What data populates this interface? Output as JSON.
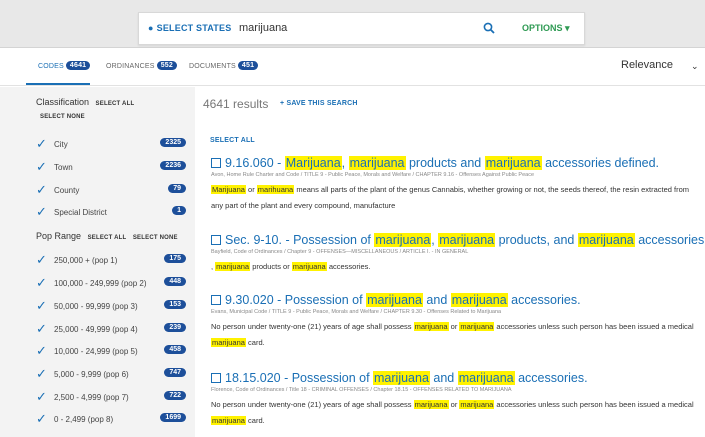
{
  "search": {
    "select_states_label": "SELECT STATES",
    "query": "marijuana",
    "options_label": "OPTIONS"
  },
  "tabs": [
    {
      "label": "CODES",
      "count": "4641",
      "active": true
    },
    {
      "label": "ORDINANCES",
      "count": "552",
      "active": false
    },
    {
      "label": "DOCUMENTS",
      "count": "451",
      "active": false
    }
  ],
  "sort": {
    "value": "Relevance"
  },
  "sidebar": {
    "classification_label": "Classification",
    "select_all": "SELECT ALL",
    "select_none": "SELECT NONE",
    "classifications": [
      {
        "label": "City",
        "count": "2325"
      },
      {
        "label": "Town",
        "count": "2236"
      },
      {
        "label": "County",
        "count": "79"
      },
      {
        "label": "Special District",
        "count": "1"
      }
    ],
    "pop_range_label": "Pop Range",
    "pop_ranges": [
      {
        "label": "250,000 + (pop 1)",
        "count": "175"
      },
      {
        "label": "100,000 - 249,999 (pop 2)",
        "count": "448"
      },
      {
        "label": "50,000 - 99,999 (pop 3)",
        "count": "153"
      },
      {
        "label": "25,000 - 49,999 (pop 4)",
        "count": "239"
      },
      {
        "label": "10,000 - 24,999 (pop 5)",
        "count": "458"
      },
      {
        "label": "5,000 - 9,999 (pop 6)",
        "count": "747"
      },
      {
        "label": "2,500 - 4,999 (pop 7)",
        "count": "722"
      },
      {
        "label": "0 - 2,499 (pop 8)",
        "count": "1699"
      }
    ]
  },
  "main": {
    "results_count": "4641 results",
    "save_search": "SAVE THIS SEARCH",
    "select_all": "SELECT ALL",
    "highlight_term": "marijuana",
    "results": [
      {
        "title": "9.16.060 - Marijuana, marijuana products and marijuana accessories defined.",
        "crumb": "Avon, Home Rule Charter and Code  /  TITLE 9 - Public Peace, Morals and Welfare  /  CHAPTER 9.16 - Offenses Against Public Peace",
        "snippet": "Marijuana or marihuana means all parts of the plant of the genus Cannabis, whether growing or not, the seeds thereof, the resin extracted from any part of the plant and every compound, manufacture"
      },
      {
        "title": "Sec. 9-10. - Possession of marijuana, marijuana products, and marijuana accessories.",
        "crumb": "Bayfield, Code of Ordinances  /  Chapter 9 - OFFENSES—MISCELLANEOUS  /  ARTICLE I. - IN GENERAL",
        "snippet": ", marijuana products or marijuana accessories."
      },
      {
        "title": "9.30.020 - Possession of marijuana and marijuana accessories.",
        "crumb": "Evans, Municipal Code  /  TITLE 9 - Public Peace, Morals and Welfare  /  CHAPTER 9.30 - Offenses Related to Marijuana",
        "snippet": "No person under twenty-one (21) years of age shall possess marijuana or marijuana accessories unless such person has been issued a medical marijuana card."
      },
      {
        "title": "18.15.020 - Possession of marijuana and marijuana accessories.",
        "crumb": "Florence, Code of Ordinances  /  Title 18 - CRIMINAL OFFENSES  /  Chapter 18.15 - OFFENSES RELATED TO MARIJUANA",
        "snippet": "No person under twenty-one (21) years of age shall possess marijuana or marijuana accessories unless such person has been issued a medical marijuana card."
      }
    ]
  },
  "colors": {
    "accent": "#1a6fb5",
    "pill": "#1d4f9a",
    "options": "#2e9a53",
    "highlight": "#fff200"
  }
}
